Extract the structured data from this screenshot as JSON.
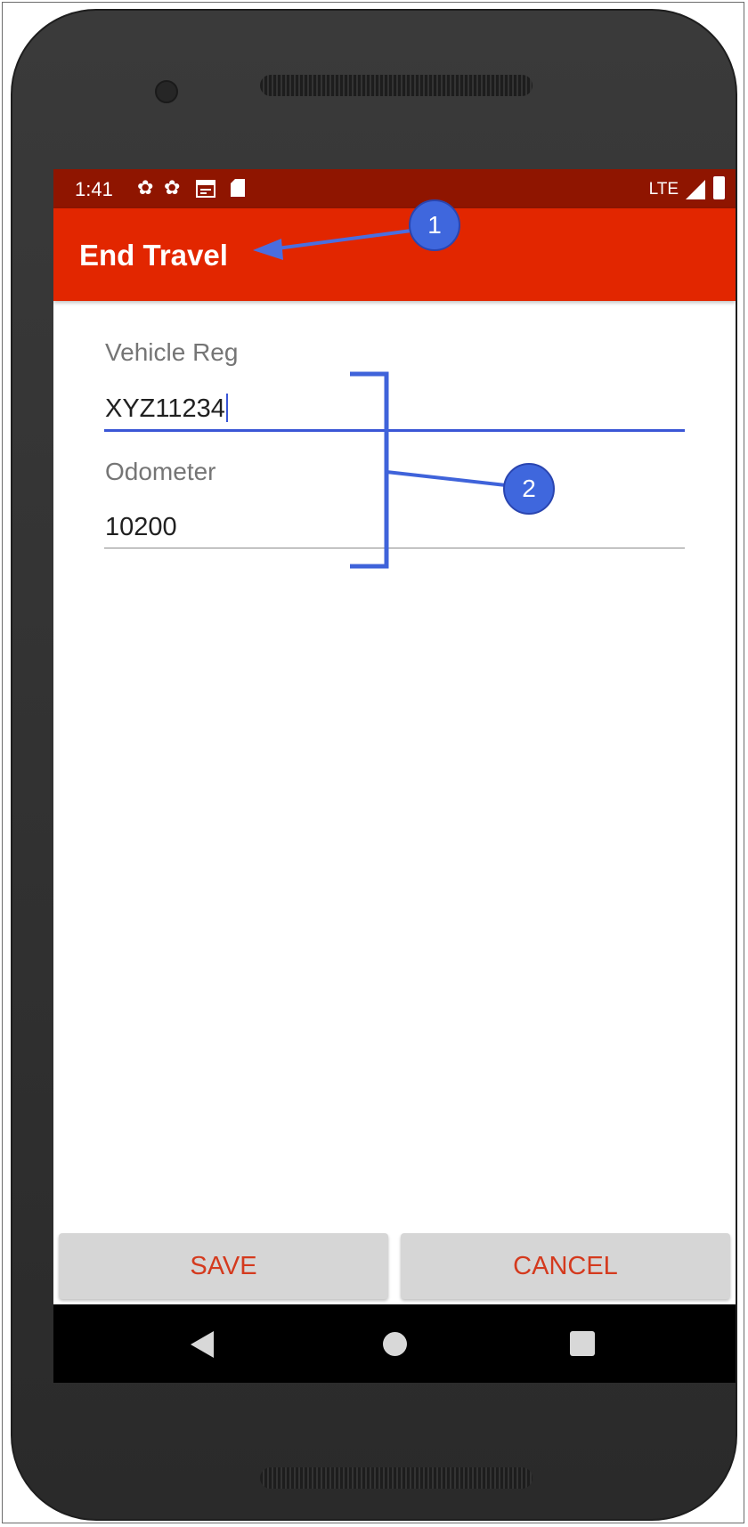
{
  "status_bar": {
    "time": "1:41",
    "network": "LTE",
    "icons": [
      "gear-icon",
      "gear-icon",
      "calendar-icon",
      "sd-card-icon",
      "signal-icon",
      "battery-icon"
    ]
  },
  "app_bar": {
    "title": "End Travel",
    "background": "#e22600"
  },
  "form": {
    "vehicle_reg": {
      "label": "Vehicle Reg",
      "value": "XYZ11234",
      "focused": true
    },
    "odometer": {
      "label": "Odometer",
      "value": "10200"
    }
  },
  "actions": {
    "save_label": "SAVE",
    "cancel_label": "CANCEL"
  },
  "nav_bar": {
    "icons": [
      "back-icon",
      "home-icon",
      "recents-icon"
    ]
  },
  "annotations": {
    "callout_1": "1",
    "callout_2": "2"
  },
  "colors": {
    "accent": "#3a56d6",
    "status_bar": "#8f1500",
    "button_text": "#d43a1e"
  }
}
